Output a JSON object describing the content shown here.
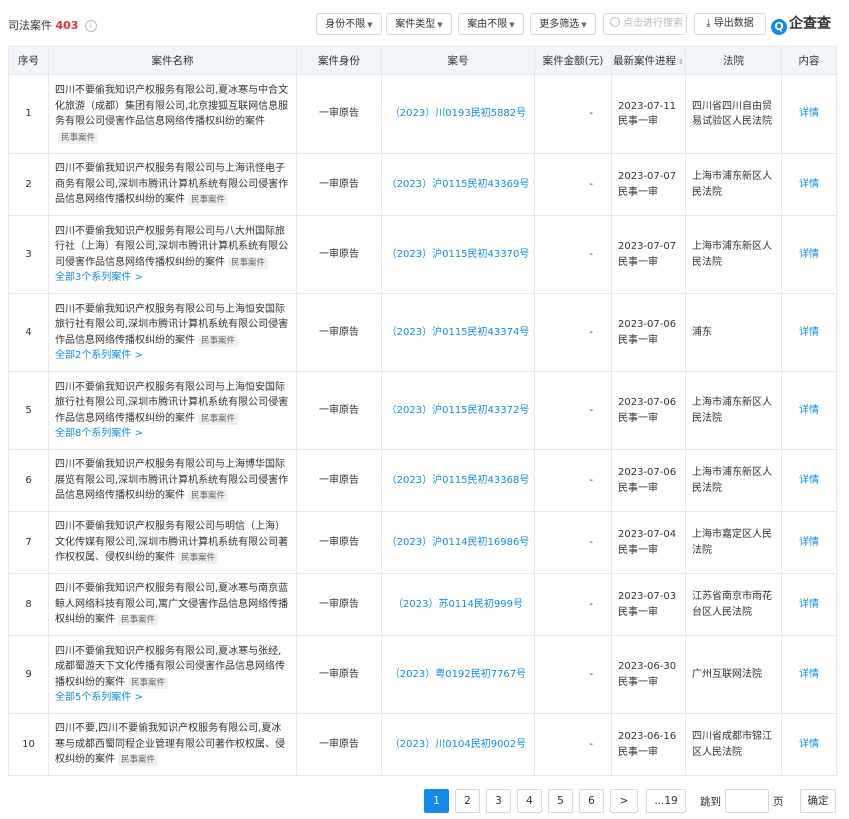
{
  "header": {
    "title": "司法案件",
    "count": "403",
    "info_glyph": "i",
    "filters": [
      "身份不限",
      "案件类型",
      "案由不限",
      "更多筛选"
    ],
    "search_placeholder": "点击进行搜索",
    "export_label": "导出数据",
    "logo_text": "企查查",
    "logo_glyph": "Q"
  },
  "table": {
    "columns": [
      "序号",
      "案件名称",
      "案件身份",
      "案号",
      "案件金额(元)",
      "最新案件进程",
      "法院",
      "内容"
    ],
    "rows": [
      {
        "no": "1",
        "name": "四川不要偷我知识产权服务有限公司,夏冰寒与中合文化旅游（成都）集团有限公司,北京搜狐互联网信息服务有限公司侵害作品信息网络传播权纠纷的案件",
        "tag": "民事案件",
        "series": "",
        "role": "一审原告",
        "case_no": "（2023）川0193民初5882号",
        "amount": "-",
        "date": "2023-07-11",
        "stage": "民事一审",
        "court": "四川省四川自由贸易试验区人民法院",
        "detail": "详情"
      },
      {
        "no": "2",
        "name": "四川不要偷我知识产权服务有限公司与上海讯怪电子商务有限公司,深圳市腾讯计算机系统有限公司侵害作品信息网络传播权纠纷的案件",
        "tag": "民事案件",
        "series": "",
        "role": "一审原告",
        "case_no": "（2023）沪0115民初43369号",
        "amount": "-",
        "date": "2023-07-07",
        "stage": "民事一审",
        "court": "上海市浦东新区人民法院",
        "detail": "详情"
      },
      {
        "no": "3",
        "name": "四川不要偷我知识产权服务有限公司与八大州国际旅行社（上海）有限公司,深圳市腾讯计算机系统有限公司侵害作品信息网络传播权纠纷的案件",
        "tag": "民事案件",
        "series": "全部3个系列案件 >",
        "role": "一审原告",
        "case_no": "（2023）沪0115民初43370号",
        "amount": "-",
        "date": "2023-07-07",
        "stage": "民事一审",
        "court": "上海市浦东新区人民法院",
        "detail": "详情"
      },
      {
        "no": "4",
        "name": "四川不要偷我知识产权服务有限公司与上海恒安国际旅行社有限公司,深圳市腾讯计算机系统有限公司侵害作品信息网络传播权纠纷的案件",
        "tag": "民事案件",
        "series": "全部2个系列案件 >",
        "role": "一审原告",
        "case_no": "（2023）沪0115民初43374号",
        "amount": "-",
        "date": "2023-07-06",
        "stage": "民事一审",
        "court": "浦东",
        "detail": "详情"
      },
      {
        "no": "5",
        "name": "四川不要偷我知识产权服务有限公司与上海恒安国际旅行社有限公司,深圳市腾讯计算机系统有限公司侵害作品信息网络传播权纠纷的案件",
        "tag": "民事案件",
        "series": "全部8个系列案件 >",
        "role": "一审原告",
        "case_no": "（2023）沪0115民初43372号",
        "amount": "-",
        "date": "2023-07-06",
        "stage": "民事一审",
        "court": "上海市浦东新区人民法院",
        "detail": "详情"
      },
      {
        "no": "6",
        "name": "四川不要偷我知识产权服务有限公司与上海博华国际展览有限公司,深圳市腾讯计算机系统有限公司侵害作品信息网络传播权纠纷的案件",
        "tag": "民事案件",
        "series": "",
        "role": "一审原告",
        "case_no": "（2023）沪0115民初43368号",
        "amount": "-",
        "date": "2023-07-06",
        "stage": "民事一审",
        "court": "上海市浦东新区人民法院",
        "detail": "详情"
      },
      {
        "no": "7",
        "name": "四川不要偷我知识产权服务有限公司与明信（上海）文化传媒有限公司,深圳市腾讯计算机系统有限公司著作权权属、侵权纠纷的案件",
        "tag": "民事案件",
        "series": "",
        "role": "一审原告",
        "case_no": "（2023）沪0114民初16986号",
        "amount": "-",
        "date": "2023-07-04",
        "stage": "民事一审",
        "court": "上海市嘉定区人民法院",
        "detail": "详情"
      },
      {
        "no": "8",
        "name": "四川不要偷我知识产权服务有限公司,夏冰寒与南京蓝鲸人网络科技有限公司,寓广文侵害作品信息网络传播权纠纷的案件",
        "tag": "民事案件",
        "series": "",
        "role": "一审原告",
        "case_no": "（2023）苏0114民初999号",
        "amount": "-",
        "date": "2023-07-03",
        "stage": "民事一审",
        "court": "江苏省南京市雨花台区人民法院",
        "detail": "详情"
      },
      {
        "no": "9",
        "name": "四川不要偷我知识产权服务有限公司,夏冰寒与张经,成都蜀游天下文化传播有限公司侵害作品信息网络传播权纠纷的案件",
        "tag": "民事案件",
        "series": "全部5个系列案件 >",
        "role": "一审原告",
        "case_no": "（2023）粤0192民初7767号",
        "amount": "-",
        "date": "2023-06-30",
        "stage": "民事一审",
        "court": "广州互联网法院",
        "detail": "详情"
      },
      {
        "no": "10",
        "name": "四川不要,四川不要偷我知识产权服务有限公司,夏冰寒与成都西蜀同程企业管理有限公司著作权权属、侵权纠纷的案件",
        "tag": "民事案件",
        "series": "",
        "role": "一审原告",
        "case_no": "（2023）川0104民初9002号",
        "amount": "-",
        "date": "2023-06-16",
        "stage": "民事一审",
        "court": "四川省成都市锦江区人民法院",
        "detail": "详情"
      }
    ]
  },
  "pagination": {
    "pages": [
      "1",
      "2",
      "3",
      "4",
      "5",
      "6"
    ],
    "next": ">",
    "last": "...19",
    "jump_label": "跳到",
    "page_unit": "页",
    "confirm": "确定"
  },
  "colors": {
    "accent": "#128bed",
    "count": "#e8302a",
    "header_bg": "#f2f6fa"
  }
}
